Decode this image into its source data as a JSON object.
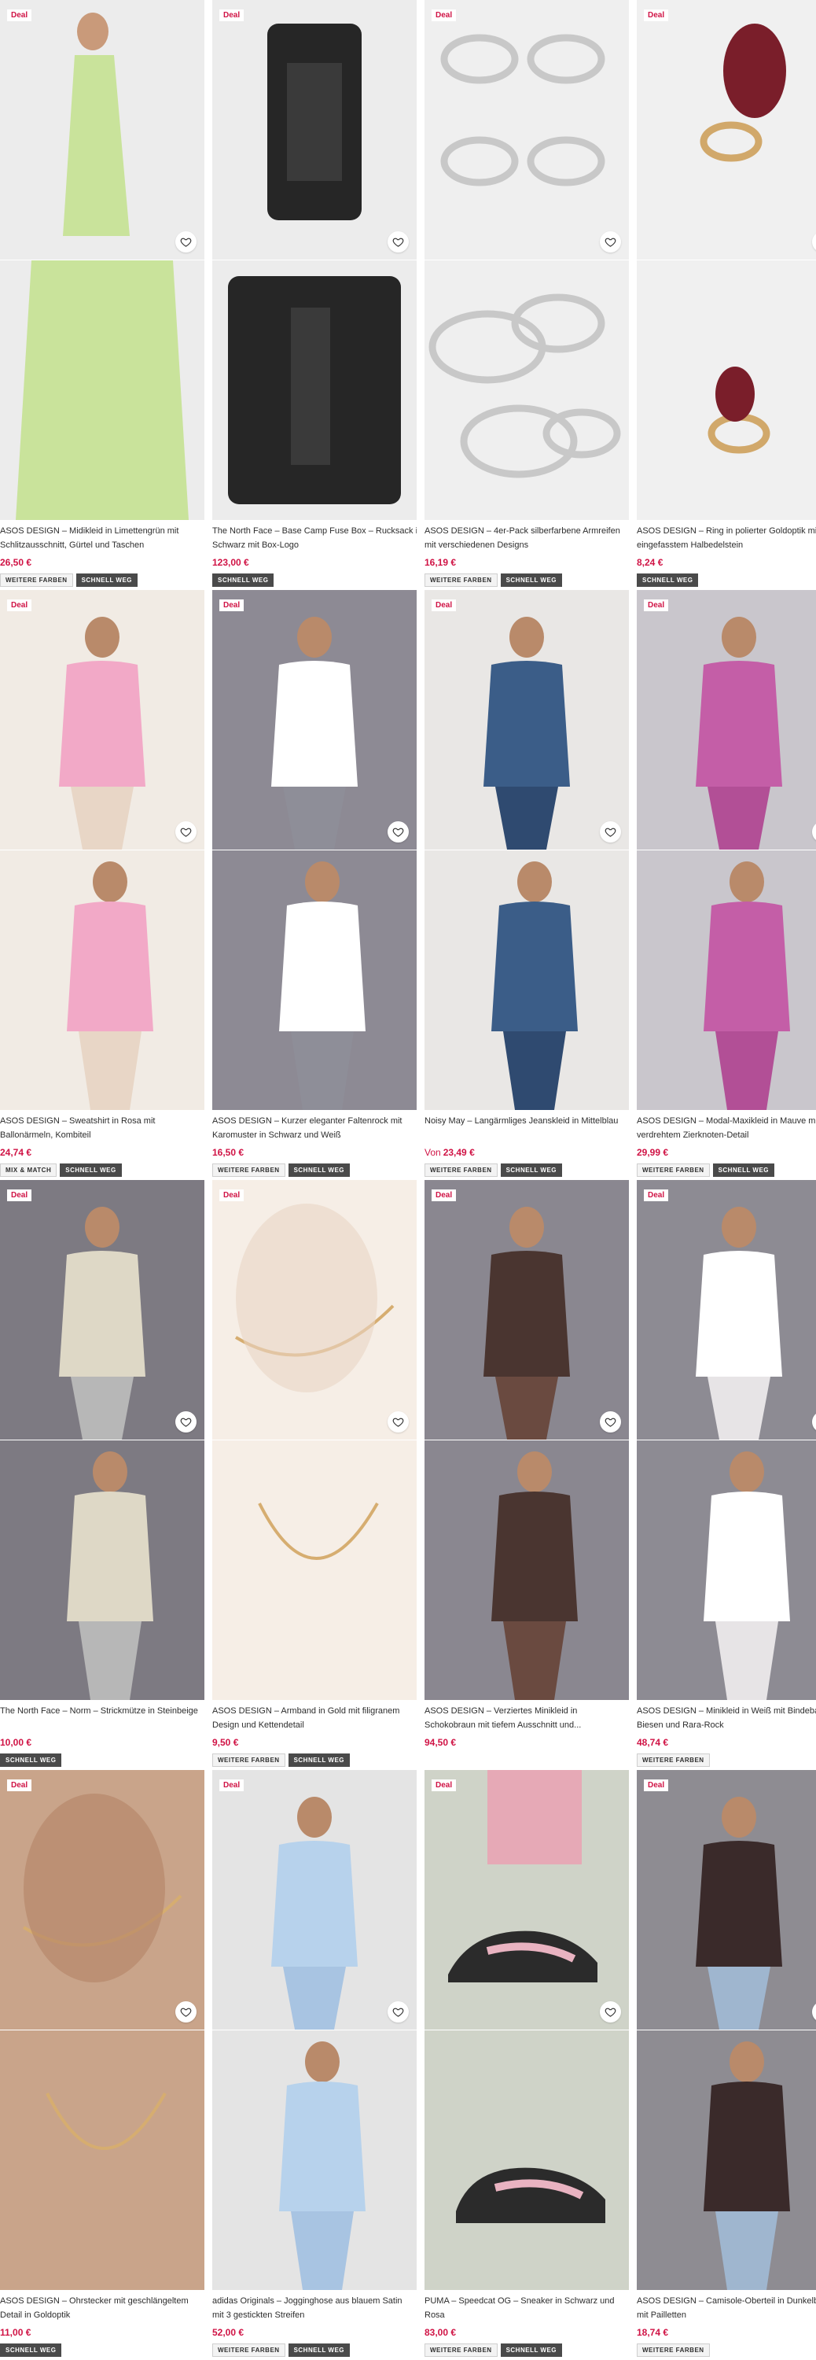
{
  "labels": {
    "deal": "Deal",
    "from_prefix": "Von"
  },
  "colors": {
    "deal_red": "#d01345",
    "price_red": "#d01345",
    "tag_dark": "#4a4a4a"
  },
  "icons": {
    "favorite": "heart-outline-icon"
  },
  "products": [
    {
      "title1": "ASOS DESIGN – Midikleid in Limettengrün mit",
      "title2": "Schlitzausschnitt, Gürtel und Taschen",
      "price": "26,50 €",
      "tags": [
        "WEITERE FARBEN",
        "SCHNELL WEG"
      ]
    },
    {
      "title1": "The North Face – Base Camp Fuse Box – Rucksack in",
      "title2": "Schwarz mit Box-Logo",
      "price": "123,00 €",
      "tags": [
        "SCHNELL WEG"
      ]
    },
    {
      "title1": "ASOS DESIGN – 4er-Pack silberfarbene Armreifen",
      "title2": "mit verschiedenen Designs",
      "price": "16,19 €",
      "tags": [
        "WEITERE FARBEN",
        "SCHNELL WEG"
      ]
    },
    {
      "title1": "ASOS DESIGN – Ring in polierter Goldoptik mit",
      "title2": "eingefasstem Halbedelstein",
      "price": "8,24 €",
      "tags": [
        "SCHNELL WEG"
      ]
    },
    {
      "title1": "ASOS DESIGN – Sweatshirt in Rosa mit",
      "title2": "Ballonärmeln, Kombiteil",
      "price": "24,74 €",
      "tags": [
        "MIX & MATCH",
        "SCHNELL WEG"
      ]
    },
    {
      "title1": "ASOS DESIGN – Kurzer eleganter Faltenrock mit",
      "title2": "Karomuster in Schwarz und Weiß",
      "price": "16,50 €",
      "tags": [
        "WEITERE FARBEN",
        "SCHNELL WEG"
      ]
    },
    {
      "title1": "Noisy May – Langärmliges Jeanskleid in Mittelblau",
      "title2": "",
      "price_prefix": "Von",
      "price": "23,49 €",
      "tags": [
        "WEITERE FARBEN",
        "SCHNELL WEG"
      ]
    },
    {
      "title1": "ASOS DESIGN – Modal-Maxikleid in Mauve mit",
      "title2": "verdrehtem Zierknoten-Detail",
      "price": "29,99 €",
      "tags": [
        "WEITERE FARBEN",
        "SCHNELL WEG"
      ]
    },
    {
      "title1": "The North Face – Norm – Strickmütze in Steinbeige",
      "title2": "",
      "price": "10,00 €",
      "tags": [
        "SCHNELL WEG"
      ]
    },
    {
      "title1": "ASOS DESIGN – Armband in Gold mit filigranem",
      "title2": "Design und Kettendetail",
      "price": "9,50 €",
      "tags": [
        "WEITERE FARBEN",
        "SCHNELL WEG"
      ]
    },
    {
      "title1": "ASOS DESIGN – Verziertes Minikleid in",
      "title2": "Schokobraun mit tiefem Ausschnitt und...",
      "price": "94,50 €",
      "tags": []
    },
    {
      "title1": "ASOS DESIGN – Minikleid in Weiß mit Bindeband,",
      "title2": "Biesen und Rara-Rock",
      "price": "48,74 €",
      "tags": [
        "WEITERE FARBEN"
      ]
    },
    {
      "title1": "ASOS DESIGN – Ohrstecker mit geschlängeltem",
      "title2": "Detail in Goldoptik",
      "price": "11,00 €",
      "tags": [
        "SCHNELL WEG"
      ]
    },
    {
      "title1": "adidas Originals – Jogginghose aus blauem Satin",
      "title2": "mit 3 gestickten Streifen",
      "price": "52,00 €",
      "tags": [
        "WEITERE FARBEN",
        "SCHNELL WEG"
      ]
    },
    {
      "title1": "PUMA – Speedcat OG – Sneaker in Schwarz und",
      "title2": "Rosa",
      "price": "83,00 €",
      "tags": [
        "WEITERE FARBEN",
        "SCHNELL WEG"
      ]
    },
    {
      "title1": "ASOS DESIGN – Camisole-Oberteil in Dunkelbraun",
      "title2": "mit Pailletten",
      "price": "18,74 €",
      "tags": [
        "WEITERE FARBEN"
      ]
    }
  ]
}
